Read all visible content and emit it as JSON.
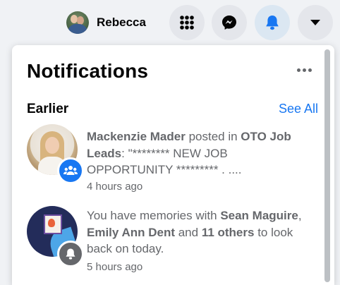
{
  "topbar": {
    "profile_name": "Rebecca",
    "buttons": [
      {
        "icon": "menu-grid-icon"
      },
      {
        "icon": "messenger-icon"
      },
      {
        "icon": "bell-icon",
        "active": true
      },
      {
        "icon": "caret-down-icon"
      }
    ]
  },
  "panel": {
    "title": "Notifications",
    "section_title": "Earlier",
    "see_all": "See All",
    "notifications": [
      {
        "actor": "Mackenzie Mader",
        "verb": " posted in ",
        "target": "OTO Job Leads",
        "rest": ": \"******** NEW JOB OPPORTUNITY ********* . ....",
        "time": "4 hours ago",
        "badge_icon": "group-icon"
      },
      {
        "prefix": "You have memories with ",
        "name1": "Sean Maguire",
        "sep1": ", ",
        "name2": "Emily Ann Dent",
        "sep2": " and ",
        "others": "11 others",
        "suffix": " to look back on today.",
        "time": "5 hours ago",
        "badge_icon": "bell-icon"
      }
    ]
  },
  "colors": {
    "accent": "#1877f2",
    "background": "#f0f2f5",
    "secondary_text": "#65676b",
    "button_bg": "#e4e6eb"
  }
}
